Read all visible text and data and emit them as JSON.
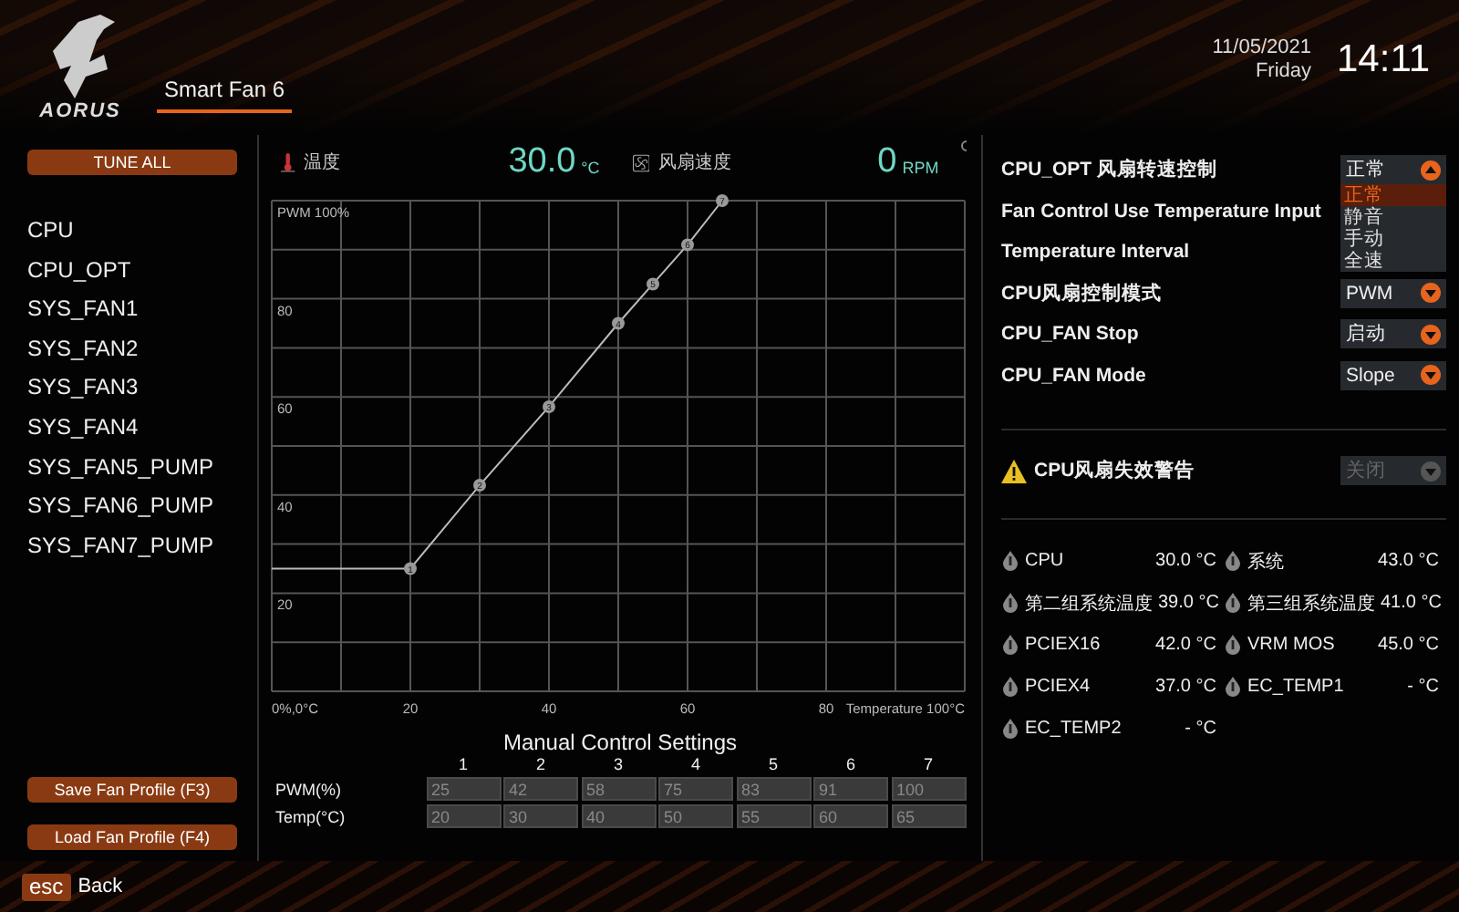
{
  "header": {
    "logo": "AORUS",
    "tab": {
      "label": "Smart Fan 6",
      "selected": true
    },
    "date": "11/05/2021",
    "day": "Friday",
    "time": "14:11"
  },
  "tune_all": "TUNE ALL",
  "fans": [
    {
      "label": "CPU"
    },
    {
      "label": "CPU_OPT"
    },
    {
      "label": "SYS_FAN1"
    },
    {
      "label": "SYS_FAN2"
    },
    {
      "label": "SYS_FAN3"
    },
    {
      "label": "SYS_FAN4"
    },
    {
      "label": "SYS_FAN5_PUMP"
    },
    {
      "label": "SYS_FAN6_PUMP"
    },
    {
      "label": "SYS_FAN7_PUMP"
    }
  ],
  "profile_buttons": [
    "Save Fan Profile (F3)",
    "Load Fan Profile (F4)"
  ],
  "readouts": {
    "temperature_label": "温度",
    "temperature": "30.0",
    "temperature_unit": "°C",
    "fan_label": "风扇速度",
    "fan_speed": "0",
    "fan_unit": "RPM"
  },
  "chart_data": {
    "type": "line",
    "x": [
      0,
      20,
      30,
      40,
      50,
      55,
      60,
      65
    ],
    "grid": true,
    "series": [
      {
        "color": "#bbbbbb",
        "marker": "circle",
        "values": [
          25,
          25,
          42,
          58,
          75,
          83,
          91,
          100
        ]
      }
    ],
    "annotations": [
      {
        "x": 20,
        "y": 25,
        "text": "1"
      },
      {
        "x": 30,
        "y": 42,
        "text": "2"
      },
      {
        "x": 40,
        "y": 58,
        "text": "3"
      },
      {
        "x": 50,
        "y": 75,
        "text": "4"
      },
      {
        "x": 55,
        "y": 83,
        "text": "5"
      },
      {
        "x": 60,
        "y": 91,
        "text": "6"
      },
      {
        "x": 65,
        "y": 100,
        "text": "7"
      }
    ],
    "xlim": [
      0,
      100
    ],
    "ylim": [
      0,
      100
    ],
    "xticks": [
      {
        "value": 0,
        "label": "0%,0°C"
      },
      20,
      40,
      60,
      80,
      {
        "value": 100,
        "label": "Temperature 100°C"
      }
    ],
    "yticks": [
      20,
      40,
      60,
      80,
      {
        "value": 100,
        "label": "PWM 100%"
      }
    ]
  },
  "manual": {
    "title": "Manual Control Settings",
    "columns": [
      "1",
      "2",
      "3",
      "4",
      "5",
      "6",
      "7"
    ],
    "rows": [
      {
        "label": "PWM(%)",
        "values": [
          "25",
          "42",
          "58",
          "75",
          "83",
          "91",
          "100"
        ]
      },
      {
        "label": "Temp(°C)",
        "values": [
          "20",
          "30",
          "40",
          "50",
          "55",
          "60",
          "65"
        ]
      }
    ]
  },
  "settings": [
    {
      "label": "CPU_OPT 风扇转速控制",
      "value": "正常",
      "expanded": true,
      "disabled": false,
      "options": [
        {
          "label": "正常",
          "selected": true
        },
        {
          "label": "静音",
          "selected": false
        },
        {
          "label": "手动",
          "selected": false
        },
        {
          "label": "全速",
          "selected": false
        }
      ]
    },
    {
      "label": "Fan Control Use Temperature Input"
    },
    {
      "label": "Temperature Interval"
    },
    {
      "label": "CPU风扇控制模式",
      "value": "PWM",
      "expanded": false,
      "disabled": false
    },
    {
      "label": "CPU_FAN Stop",
      "value": "启动",
      "expanded": false,
      "disabled": false
    },
    {
      "label": "CPU_FAN Mode",
      "value": "Slope",
      "expanded": false,
      "disabled": false
    }
  ],
  "warning": {
    "label": "CPU风扇失效警告",
    "value": "关闭",
    "expanded": false,
    "disabled": true
  },
  "temperatures": [
    {
      "label": "CPU",
      "value": "30.0 °C"
    },
    {
      "label": "系统",
      "value": "43.0 °C"
    },
    {
      "label": "第二组系统温度",
      "value": "39.0 °C"
    },
    {
      "label": "第三组系统温度",
      "value": "41.0 °C"
    },
    {
      "label": "PCIEX16",
      "value": "42.0 °C"
    },
    {
      "label": "VRM MOS",
      "value": "45.0 °C"
    },
    {
      "label": "PCIEX4",
      "value": "37.0 °C"
    },
    {
      "label": "EC_TEMP1",
      "value": "- °C"
    },
    {
      "label": "EC_TEMP2",
      "value": "- °C"
    }
  ],
  "footer": {
    "key": "esc",
    "label": "Back"
  }
}
